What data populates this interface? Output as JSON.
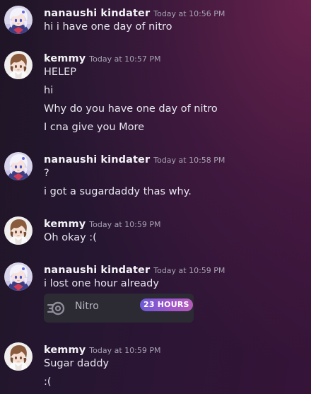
{
  "colors": {
    "background_start": "#201526",
    "background_end": "#351438",
    "username": "#f2f2f5",
    "timestamp": "#a7a3b2",
    "message_text": "#e6e6ee",
    "gift_card_bg": "#2c2a33",
    "badge_gradient_start": "#6d5bd6",
    "badge_gradient_end": "#b35ab8"
  },
  "messages": [
    {
      "author": "nanaushi kindater",
      "timestamp": "Today at 10:56 PM",
      "avatar_icon": "anime-avatar-white-hair",
      "lines": [
        "hi i have one day of nitro"
      ]
    },
    {
      "author": "kemmy",
      "timestamp": "Today at 10:57 PM",
      "avatar_icon": "anime-avatar-brown-hair",
      "lines": [
        "HELEP",
        "hi",
        "Why do you have one day of nitro",
        "I cna give you More"
      ]
    },
    {
      "author": "nanaushi kindater",
      "timestamp": "Today at 10:58 PM",
      "avatar_icon": "anime-avatar-white-hair",
      "lines": [
        "?",
        "i got a sugardaddy thas why."
      ]
    },
    {
      "author": "kemmy",
      "timestamp": "Today at 10:59 PM",
      "avatar_icon": "anime-avatar-brown-hair",
      "lines": [
        "Oh okay :("
      ]
    },
    {
      "author": "nanaushi kindater",
      "timestamp": "Today at 10:59 PM",
      "avatar_icon": "anime-avatar-white-hair",
      "lines": [
        "i lost one hour already"
      ],
      "gift": {
        "icon": "nitro-icon",
        "label": "Nitro",
        "badge": "23 HOURS"
      }
    },
    {
      "author": "kemmy",
      "timestamp": "Today at 10:59 PM",
      "avatar_icon": "anime-avatar-brown-hair",
      "lines": [
        "Sugar daddy",
        ":("
      ]
    }
  ]
}
